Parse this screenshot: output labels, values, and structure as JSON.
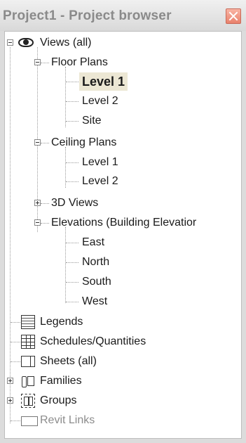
{
  "window": {
    "title": "Project1 - Project browser"
  },
  "tree": {
    "root": {
      "label": "Views (all)"
    },
    "floor_plans": {
      "label": "Floor Plans",
      "items": [
        "Level 1",
        "Level 2",
        "Site"
      ],
      "selected": "Level 1"
    },
    "ceiling_plans": {
      "label": "Ceiling Plans",
      "items": [
        "Level 1",
        "Level 2"
      ]
    },
    "views_3d": {
      "label": "3D Views"
    },
    "elevations": {
      "label": "Elevations (Building Elevatior",
      "items": [
        "East",
        "North",
        "South",
        "West"
      ]
    },
    "legends": {
      "label": "Legends",
      "icon": "legend-icon"
    },
    "schedules": {
      "label": "Schedules/Quantities",
      "icon": "schedule-icon"
    },
    "sheets": {
      "label": "Sheets (all)",
      "icon": "sheet-icon"
    },
    "families": {
      "label": "Families",
      "icon": "families-icon"
    },
    "groups": {
      "label": "Groups",
      "icon": "groups-icon"
    },
    "revit_links": {
      "label": "Revit Links",
      "icon": "revit-links-icon"
    }
  },
  "colors": {
    "selection": "#ece7d4",
    "close_button": "#e9816c",
    "title_text": "#8a8a8a"
  }
}
